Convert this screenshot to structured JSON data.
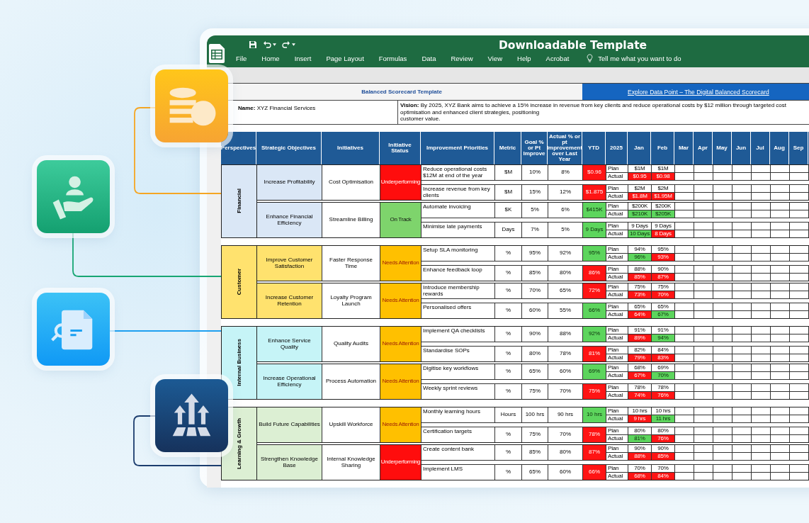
{
  "window": {
    "title": "Downloadable Template"
  },
  "menu": [
    "File",
    "Home",
    "Insert",
    "Page Layout",
    "Formulas",
    "Data",
    "Review",
    "View",
    "Help",
    "Acrobat"
  ],
  "tell_me": "Tell me what you want to do",
  "sheet": {
    "title": "Balanced Scorecard Template",
    "link": "Explore Data Point – The Digital Balanced Scorecard",
    "company": "**Name:** XYZ Financial Services",
    "vision": "**Vision:** By 2025, XYZ Bank aims to achieve a 15% increase in revenue from key clients and reduce operational costs by $12 million  through targeted cost optimisation and enhanced client strategies, positioning\ncustomer value."
  },
  "table": {
    "columns": [
      "Perspectives",
      "Strategic Objectives",
      "Initiatives",
      "Initiative Status",
      "Improvement Priorities",
      "Metric",
      "Goal % or Pt Improve",
      "Actual %  or pt Improvement over Last Year",
      "YTD",
      "2025",
      "Jan",
      "Feb",
      "Mar",
      "Apr",
      "May",
      "Jun",
      "Jul",
      "Aug",
      "Sep"
    ],
    "groups": [
      {
        "name": "Financial",
        "color": "#dae7f6",
        "objectives": [
          {
            "name": "Increase Profitability",
            "initiative": "Cost Optimisation",
            "status": {
              "kind": "underperforming",
              "label": "Underperforming"
            },
            "priorities": [
              {
                "text": "Reduce operational costs $12M  at end of the year",
                "metric": "$M",
                "goal": "10%",
                "actual": "8%",
                "ytd": "$0.96",
                "ytd_on_target": false,
                "plan_label": "Plan",
                "actual_label": "Actual",
                "plan": [
                  "$1M",
                  "$1M"
                ],
                "actuals": [
                  {
                    "value": "$0.95",
                    "on_target": false
                  },
                  {
                    "value": "$0.98",
                    "on_target": false
                  }
                ]
              },
              {
                "text": "Increase revenue from key clients",
                "metric": "$M",
                "goal": "15%",
                "actual": "12%",
                "ytd": "$1.875",
                "ytd_on_target": false,
                "plan_label": "Plan",
                "actual_label": "Actual",
                "plan": [
                  "$2M",
                  "$2M"
                ],
                "actuals": [
                  {
                    "value": "$1.8M",
                    "on_target": false
                  },
                  {
                    "value": "$1.95M",
                    "on_target": false
                  }
                ]
              }
            ]
          },
          {
            "name": "Enhance Financial Efficiency",
            "initiative": "Streamline Billing",
            "status": {
              "kind": "on_track",
              "label": "On Track"
            },
            "priorities": [
              {
                "text": "Automate invoicing",
                "metric": "$K",
                "goal": "5%",
                "actual": "6%",
                "ytd": "$415K",
                "ytd_on_target": true,
                "plan_label": "Plan",
                "actual_label": "Actual",
                "plan": [
                  "$200K",
                  "$200K"
                ],
                "actuals": [
                  {
                    "value": "$210K",
                    "on_target": true
                  },
                  {
                    "value": "$205K",
                    "on_target": true
                  }
                ]
              },
              {
                "text": "Minimise late payments",
                "metric": "Days",
                "goal": "7%",
                "actual": "5%",
                "ytd": "9 Days",
                "ytd_on_target": true,
                "plan_label": "Plan",
                "actual_label": "Actual",
                "plan": [
                  "9 Days",
                  "9 Days"
                ],
                "actuals": [
                  {
                    "value": "10 Days",
                    "on_target": true
                  },
                  {
                    "value": "8 Days",
                    "on_target": false
                  }
                ]
              }
            ]
          }
        ]
      },
      {
        "name": "Customer",
        "color": "#ffe26e",
        "objectives": [
          {
            "name": "Improve Customer Satisfaction",
            "initiative": "Faster Response Time",
            "status": {
              "kind": "needs_attention",
              "label": "Needs Attention"
            },
            "priorities": [
              {
                "text": "Setup SLA monitoring",
                "metric": "%",
                "goal": "95%",
                "actual": "92%",
                "ytd": "95%",
                "ytd_on_target": true,
                "plan_label": "Plan",
                "actual_label": "Actual",
                "plan": [
                  "94%",
                  "95%"
                ],
                "actuals": [
                  {
                    "value": "96%",
                    "on_target": true
                  },
                  {
                    "value": "93%",
                    "on_target": false
                  }
                ]
              },
              {
                "text": "Enhance feedback loop",
                "metric": "%",
                "goal": "85%",
                "actual": "80%",
                "ytd": "86%",
                "ytd_on_target": false,
                "plan_label": "Plan",
                "actual_label": "Actual",
                "plan": [
                  "88%",
                  "90%"
                ],
                "actuals": [
                  {
                    "value": "85%",
                    "on_target": false
                  },
                  {
                    "value": "87%",
                    "on_target": false
                  }
                ]
              }
            ]
          },
          {
            "name": "Increase Customer Retention",
            "initiative": "Loyalty Program Launch",
            "status": {
              "kind": "needs_attention",
              "label": "Needs Attention"
            },
            "priorities": [
              {
                "text": "Introduce membership rewards",
                "metric": "%",
                "goal": "70%",
                "actual": "65%",
                "ytd": "72%",
                "ytd_on_target": false,
                "plan_label": "Plan",
                "actual_label": "Actual",
                "plan": [
                  "75%",
                  "75%"
                ],
                "actuals": [
                  {
                    "value": "73%",
                    "on_target": false
                  },
                  {
                    "value": "70%",
                    "on_target": false
                  }
                ]
              },
              {
                "text": "Personalised offers",
                "metric": "%",
                "goal": "60%",
                "actual": "55%",
                "ytd": "66%",
                "ytd_on_target": true,
                "plan_label": "Plan",
                "actual_label": "Actual",
                "plan": [
                  "65%",
                  "65%"
                ],
                "actuals": [
                  {
                    "value": "64%",
                    "on_target": false
                  },
                  {
                    "value": "67%",
                    "on_target": true
                  }
                ]
              }
            ]
          }
        ]
      },
      {
        "name": "Internal Business",
        "color": "#c6f4f7",
        "objectives": [
          {
            "name": "Enhance Service Quality",
            "initiative": "Quality Audits",
            "status": {
              "kind": "needs_attention",
              "label": "Needs Attention"
            },
            "priorities": [
              {
                "text": "Implement QA checklists",
                "metric": "%",
                "goal": "90%",
                "actual": "88%",
                "ytd": "92%",
                "ytd_on_target": true,
                "plan_label": "Plan",
                "actual_label": "Actual",
                "plan": [
                  "91%",
                  "91%"
                ],
                "actuals": [
                  {
                    "value": "89%",
                    "on_target": false
                  },
                  {
                    "value": "94%",
                    "on_target": true
                  }
                ]
              },
              {
                "text": "Standardise SOPs",
                "metric": "%",
                "goal": "80%",
                "actual": "78%",
                "ytd": "81%",
                "ytd_on_target": false,
                "plan_label": "Plan",
                "actual_label": "Actual",
                "plan": [
                  "82%",
                  "84%"
                ],
                "actuals": [
                  {
                    "value": "79%",
                    "on_target": false
                  },
                  {
                    "value": "83%",
                    "on_target": false
                  }
                ]
              }
            ]
          },
          {
            "name": "Increase Operational Efficiency",
            "initiative": "Process Automation",
            "status": {
              "kind": "needs_attention",
              "label": "Needs Attention"
            },
            "priorities": [
              {
                "text": "Digitise key workflows",
                "metric": "%",
                "goal": "65%",
                "actual": "60%",
                "ytd": "69%",
                "ytd_on_target": true,
                "plan_label": "Plan",
                "actual_label": "Actual",
                "plan": [
                  "68%",
                  "69%"
                ],
                "actuals": [
                  {
                    "value": "67%",
                    "on_target": false
                  },
                  {
                    "value": "70%",
                    "on_target": true
                  }
                ]
              },
              {
                "text": "Weekly sprint reviews",
                "metric": "%",
                "goal": "75%",
                "actual": "70%",
                "ytd": "75%",
                "ytd_on_target": false,
                "plan_label": "Plan",
                "actual_label": "Actual",
                "plan": [
                  "78%",
                  "78%"
                ],
                "actuals": [
                  {
                    "value": "74%",
                    "on_target": false
                  },
                  {
                    "value": "76%",
                    "on_target": false
                  }
                ]
              }
            ]
          }
        ]
      },
      {
        "name": "Learning & Growth",
        "color": "#dcefd3",
        "objectives": [
          {
            "name": "Build Future Capabilities",
            "initiative": "Upskill Workforce",
            "status": {
              "kind": "needs_attention",
              "label": "Needs Attention"
            },
            "priorities": [
              {
                "text": "Monthly learning hours",
                "metric": "Hours",
                "goal": "100 hrs",
                "actual": "90 hrs",
                "ytd": "10 hrs",
                "ytd_on_target": true,
                "plan_label": "Plan",
                "actual_label": "Actual",
                "plan": [
                  "10 hrs",
                  "10 hrs"
                ],
                "actuals": [
                  {
                    "value": "9 hrs",
                    "on_target": false
                  },
                  {
                    "value": "11 hrs",
                    "on_target": true
                  }
                ]
              },
              {
                "text": "Certification targets",
                "metric": "%",
                "goal": "75%",
                "actual": "70%",
                "ytd": "78%",
                "ytd_on_target": false,
                "plan_label": "Plan",
                "actual_label": "Actual",
                "plan": [
                  "80%",
                  "80%"
                ],
                "actuals": [
                  {
                    "value": "81%",
                    "on_target": true
                  },
                  {
                    "value": "76%",
                    "on_target": false
                  }
                ]
              }
            ]
          },
          {
            "name": "Strengthen Knowledge Base",
            "initiative": "Internal Knowledge Sharing",
            "status": {
              "kind": "underperforming",
              "label": "Underperforming"
            },
            "priorities": [
              {
                "text": "Create content bank",
                "metric": "%",
                "goal": "85%",
                "actual": "80%",
                "ytd": "87%",
                "ytd_on_target": false,
                "plan_label": "Plan",
                "actual_label": "Actual",
                "plan": [
                  "90%",
                  "90%"
                ],
                "actuals": [
                  {
                    "value": "88%",
                    "on_target": false
                  },
                  {
                    "value": "85%",
                    "on_target": false
                  }
                ]
              },
              {
                "text": "Implement LMS",
                "metric": "%",
                "goal": "65%",
                "actual": "60%",
                "ytd": "66%",
                "ytd_on_target": false,
                "plan_label": "Plan",
                "actual_label": "Actual",
                "plan": [
                  "70%",
                  "70%"
                ],
                "actuals": [
                  {
                    "value": "68%",
                    "on_target": false
                  },
                  {
                    "value": "84%",
                    "on_target": false
                  }
                ]
              }
            ]
          }
        ]
      }
    ]
  }
}
